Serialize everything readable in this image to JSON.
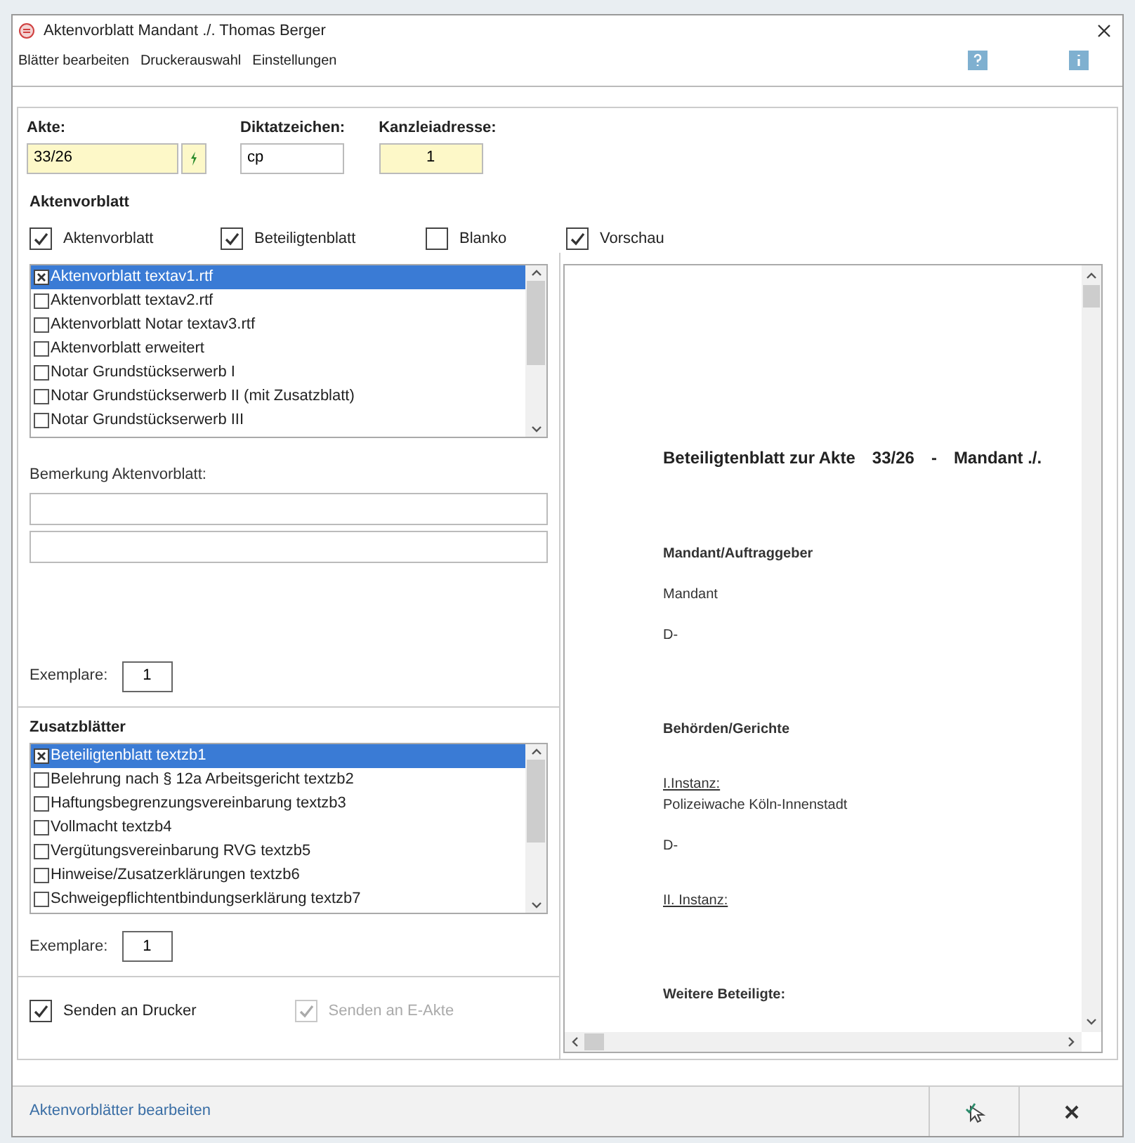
{
  "window": {
    "title": "Aktenvorblatt Mandant ./. Thomas Berger"
  },
  "menu": [
    "Blätter bearbeiten",
    "Druckerauswahl",
    "Einstellungen"
  ],
  "header_fields": [
    {
      "label": "Akte:",
      "value": "33/26",
      "highlighted": true,
      "has_button": true
    },
    {
      "label": "Diktatzeichen:",
      "value": "cp",
      "highlighted": false,
      "has_button": false
    },
    {
      "label": "Kanzleiadresse:",
      "value": "1",
      "highlighted": true,
      "has_button": false
    }
  ],
  "aktenvorblatt": {
    "title": "Aktenvorblatt",
    "options": [
      {
        "label": "Aktenvorblatt",
        "checked": true
      },
      {
        "label": "Beteiligtenblatt",
        "checked": true
      },
      {
        "label": "Blanko",
        "checked": false
      },
      {
        "label": "Vorschau",
        "checked": true
      }
    ],
    "items": [
      {
        "label": "Aktenvorblatt  textav1.rtf",
        "checked": true,
        "selected": true
      },
      {
        "label": "Aktenvorblatt  textav2.rtf",
        "checked": false,
        "selected": false
      },
      {
        "label": "Aktenvorblatt Notar   textav3.rtf",
        "checked": false,
        "selected": false
      },
      {
        "label": "Aktenvorblatt erweitert",
        "checked": false,
        "selected": false
      },
      {
        "label": "Notar Grundstückserwerb I",
        "checked": false,
        "selected": false
      },
      {
        "label": "Notar Grundstückserwerb II (mit Zusatzblatt)",
        "checked": false,
        "selected": false
      },
      {
        "label": "Notar Grundstückserwerb III",
        "checked": false,
        "selected": false
      }
    ],
    "remark_label": "Bemerkung Aktenvorblatt:",
    "copies": {
      "label": "Exemplare:",
      "value": "1"
    }
  },
  "zusatzblaetter": {
    "title": "Zusatzblätter",
    "items": [
      {
        "label": "Beteiligtenblatt  textzb1",
        "checked": true,
        "selected": true
      },
      {
        "label": "Belehrung nach § 12a Arbeitsgericht  textzb2",
        "checked": false,
        "selected": false
      },
      {
        "label": "Haftungsbegrenzungsvereinbarung  textzb3",
        "checked": false,
        "selected": false
      },
      {
        "label": "Vollmacht  textzb4",
        "checked": false,
        "selected": false
      },
      {
        "label": "Vergütungsvereinbarung RVG  textzb5",
        "checked": false,
        "selected": false
      },
      {
        "label": "Hinweise/Zusatzerklärungen  textzb6",
        "checked": false,
        "selected": false
      },
      {
        "label": "Schweigepflichtentbindungserklärung  textzb7",
        "checked": false,
        "selected": false
      }
    ],
    "copies": {
      "label": "Exemplare:",
      "value": "1"
    }
  },
  "send_options": [
    {
      "label": "Senden an Drucker",
      "checked": true,
      "disabled": false
    },
    {
      "label": "Senden an E-Akte",
      "checked": true,
      "disabled": true
    }
  ],
  "preview": {
    "title": [
      "Beteiligtenblatt zur Akte",
      "33/26",
      "-",
      "Mandant ./."
    ],
    "lines": [
      {
        "kind": "heading",
        "text": "Mandant/Auftraggeber"
      },
      {
        "kind": "text",
        "text": "Mandant"
      },
      {
        "kind": "text",
        "text": "D-"
      },
      {
        "kind": "heading",
        "text": "Behörden/Gerichte"
      },
      {
        "kind": "underlined",
        "text": "I.Instanz:"
      },
      {
        "kind": "plain",
        "text": "Polizeiwache Köln-Innenstadt"
      },
      {
        "kind": "text",
        "text": "D-"
      },
      {
        "kind": "underlined",
        "text": "II. Instanz:"
      },
      {
        "kind": "heading",
        "text": "Weitere Beteiligte:"
      }
    ]
  },
  "footer": {
    "link": "Aktenvorblätter bearbeiten"
  }
}
